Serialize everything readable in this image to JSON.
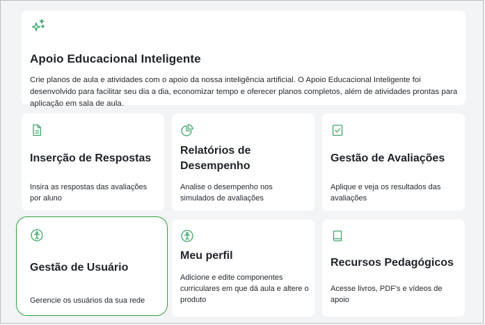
{
  "hero": {
    "icon": "sparkles-icon",
    "title": "Apoio Educacional Inteligente",
    "description": "Crie planos de aula e atividades com o apoio da nossa inteligência artificial. O Apoio Educacional Inteligente foi desenvolvido para facilitar seu dia a dia, economizar tempo e oferecer planos completos, além de atividades prontas para aplicação em sala de aula."
  },
  "cards": [
    {
      "icon": "document-icon",
      "title": "Inserção de Respostas",
      "description": "Insira as respostas das avaliações por aluno"
    },
    {
      "icon": "pie-chart-icon",
      "title": "Relatórios de Desempenho",
      "description": "Analise o desempenho nos simulados de avaliações"
    },
    {
      "icon": "clipboard-check-icon",
      "title": "Gestão de Avaliações",
      "description": "Aplique e veja os resultados das avaliações"
    },
    {
      "icon": "person-circle-icon",
      "title": "Gestão de Usuário",
      "description": "Gerencie os usuários da sua rede",
      "selected": true
    },
    {
      "icon": "person-circle-icon",
      "title": "Meu perfil",
      "description": "Adicione e edite componentes curriculares em que dá aula e altere o produto"
    },
    {
      "icon": "book-icon",
      "title": "Recursos Pedagógicos",
      "description": "Acesse livros, PDF's e vídeos de apoio"
    }
  ],
  "colors": {
    "accent": "#2ea043",
    "icon": "#3fa66a",
    "card_bg": "#ffffff",
    "page_bg": "#f3f4f6"
  }
}
